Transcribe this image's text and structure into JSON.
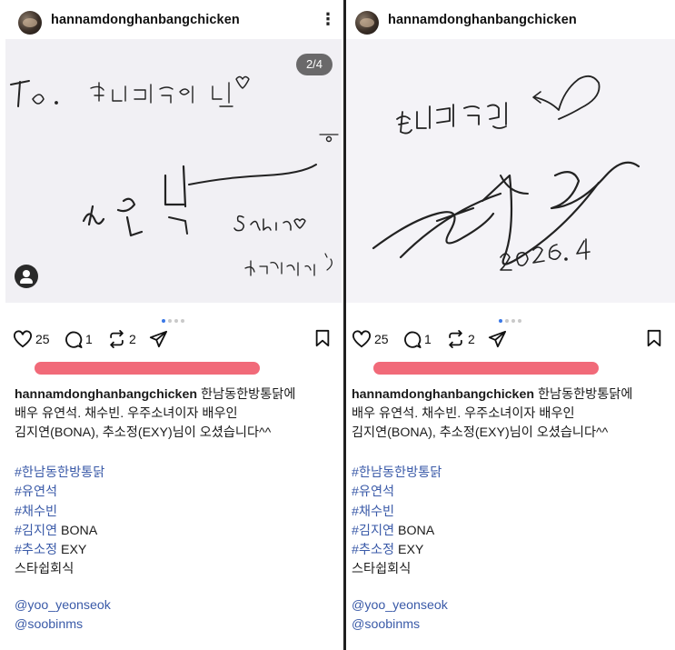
{
  "posts": [
    {
      "username": "hannamdonghanbangchicken",
      "counter": "2/4",
      "likes": "25",
      "comments": "1",
      "reposts": "2",
      "caption_user": "hannamdonghanbangchicken",
      "caption_line1_suffix": " 한남동한방통닭에",
      "caption_line2": "배우 유연석. 채수빈. 우주소녀이자 배우인",
      "caption_line3": "김지연(BONA), 추소정(EXY)님이 오셨습니다^^",
      "hashtags": [
        {
          "tag": "#한남동한방통닭",
          "extra": ""
        },
        {
          "tag": "#유연석",
          "extra": ""
        },
        {
          "tag": "#채수빈",
          "extra": ""
        },
        {
          "tag": "#김지연",
          "extra": " BONA"
        },
        {
          "tag": "#추소정",
          "extra": " EXY"
        }
      ],
      "plain_line": "스타쉽회식",
      "mentions": [
        "@yoo_yeonseok",
        "@soobinms"
      ],
      "signature_text": {
        "to": "To.",
        "dedication": "한방통닭 빈♡",
        "name": "채수빈",
        "romanized": "Sabin♡",
        "closing": "감사합니다 :)"
      }
    },
    {
      "username": "hannamdonghanbangchicken",
      "likes": "25",
      "comments": "1",
      "reposts": "2",
      "caption_user": "hannamdonghanbangchicken",
      "caption_line1_suffix": " 한남동한방통닭에",
      "caption_line2": "배우 유연석. 채수빈. 우주소녀이자 배우인",
      "caption_line3": "김지연(BONA), 추소정(EXY)님이 오셨습니다^^",
      "hashtags": [
        {
          "tag": "#한남동한방통닭",
          "extra": ""
        },
        {
          "tag": "#유연석",
          "extra": ""
        },
        {
          "tag": "#채수빈",
          "extra": ""
        },
        {
          "tag": "#김지연",
          "extra": " BONA"
        },
        {
          "tag": "#추소정",
          "extra": " EXY"
        }
      ],
      "plain_line": "스타쉽회식",
      "mentions": [
        "@yoo_yeonseok",
        "@soobinms"
      ],
      "signature_text": {
        "dedication": "한방통닭",
        "date": "2026. 4"
      }
    }
  ],
  "colors": {
    "link": "#3a5aa8",
    "dot_active": "#3a78e7",
    "redaction": "#ef5a6a"
  },
  "icons": [
    "heart-icon",
    "comment-icon",
    "repost-icon",
    "share-icon",
    "bookmark-icon",
    "more-icon",
    "person-tag-icon"
  ]
}
